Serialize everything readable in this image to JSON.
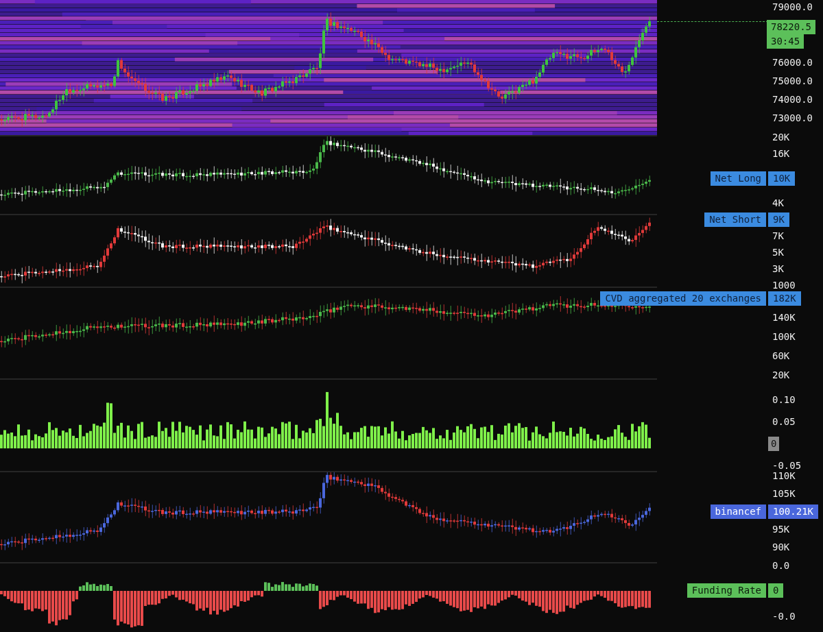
{
  "panes": [
    {
      "kind": "price",
      "ticks": [
        "79000.0",
        "76000.0",
        "75000.0",
        "74000.0",
        "73000.0"
      ],
      "badge": {
        "value": "78220.5",
        "sub": "30:45",
        "color": "#5cc05a"
      }
    },
    {
      "kind": "long",
      "ticks": [
        "20K",
        "16K",
        "4K"
      ],
      "badge": {
        "label": "Net Long",
        "value": "10K",
        "color": "#3b8be0"
      }
    },
    {
      "kind": "short",
      "ticks": [
        "7K",
        "5K",
        "3K",
        "1000"
      ],
      "badge": {
        "label": "Net Short",
        "value": "9K",
        "color": "#3b8be0"
      }
    },
    {
      "kind": "cvd",
      "ticks": [
        "140K",
        "100K",
        "60K",
        "20K"
      ],
      "badge": {
        "label": "CVD aggregated 20 exchanges",
        "value": "182K",
        "color": "#3b8be0"
      }
    },
    {
      "kind": "volume",
      "ticks": [
        "0.10",
        "0.05",
        "-0.05"
      ],
      "badge": {
        "value": "0",
        "color": "#8a8a8a"
      }
    },
    {
      "kind": "binance",
      "ticks": [
        "110K",
        "105K",
        "95K",
        "90K"
      ],
      "badge": {
        "label": "binancef",
        "value": "100.21K",
        "color": "#4a67dc"
      }
    },
    {
      "kind": "funding",
      "ticks": [
        "0.0",
        "-0.0"
      ],
      "badge": {
        "label": "Funding Rate",
        "value": "0",
        "color": "#5cc05a"
      }
    }
  ]
}
